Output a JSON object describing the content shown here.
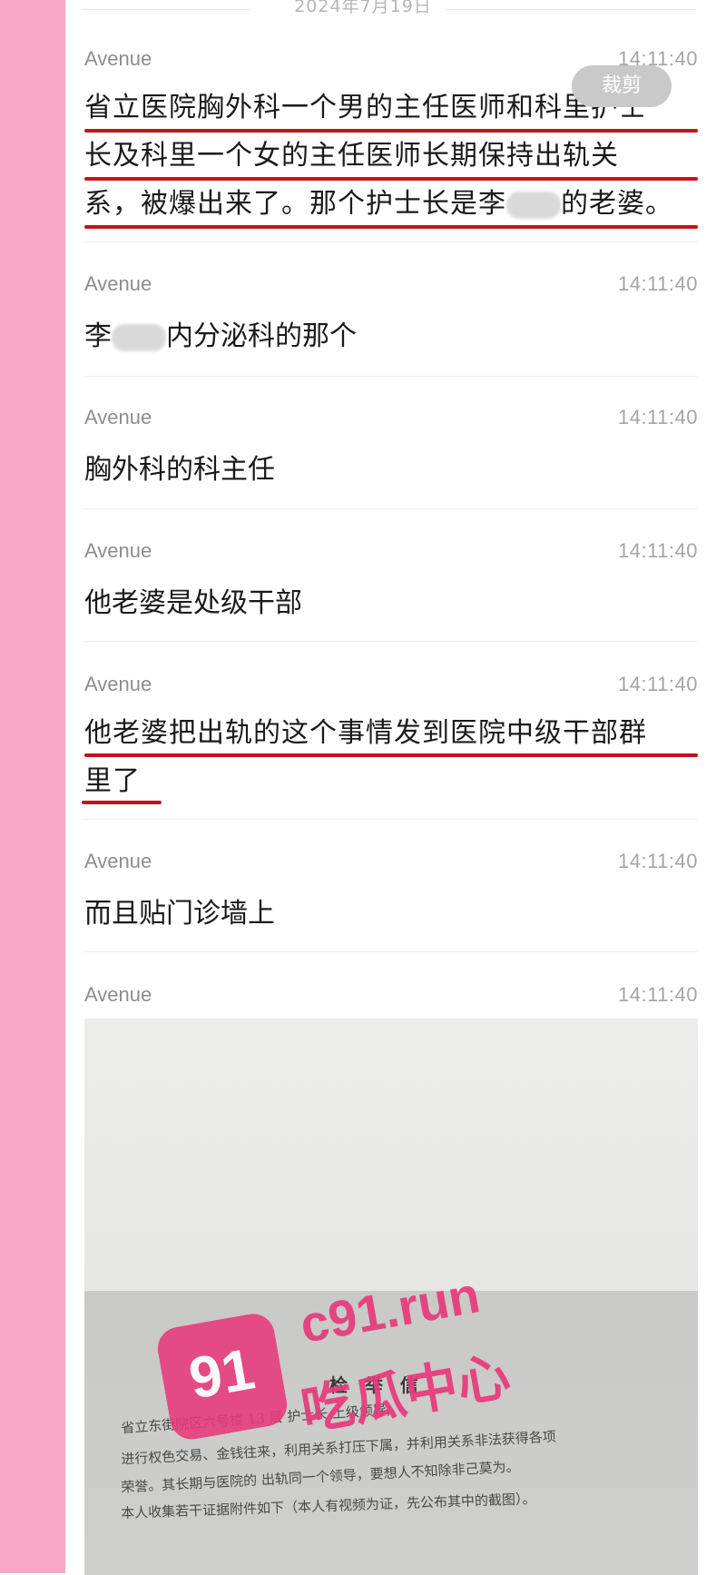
{
  "date_divider": "2024年7月19日",
  "crop_button": "裁剪",
  "messages": [
    {
      "sender": "Avenue",
      "time": "14:11:40",
      "lines": [
        "省立医院胸外科一个男的主任医师和科里护士",
        "长及科里一个女的主任医师长期保持出轨关",
        "系，被爆出来了。那个护士长是李",
        "的老婆。"
      ]
    },
    {
      "sender": "Avenue",
      "time": "14:11:40",
      "pre": "李",
      "post": "内分泌科的那个"
    },
    {
      "sender": "Avenue",
      "time": "14:11:40",
      "text": "胸外科的科主任"
    },
    {
      "sender": "Avenue",
      "time": "14:11:40",
      "text": "他老婆是处级干部"
    },
    {
      "sender": "Avenue",
      "time": "14:11:40",
      "lines": [
        "他老婆把出轨的这个事情发到医院中级干部群",
        "里了"
      ]
    },
    {
      "sender": "Avenue",
      "time": "14:11:40",
      "text": "而且贴门诊墙上"
    },
    {
      "sender": "Avenue",
      "time": "14:11:40"
    }
  ],
  "photo": {
    "title": "检 举 信",
    "lines": [
      "省立东街院区六号楼 13 层          护士长          上级领导,",
      "进行权色交易、金钱往来，利用关系打压下属，并利用关系非法获得各项",
      "荣誉。其长期与医院的          出轨同一个领导，要想人不知除非己莫为。",
      "本人收集若干证据附件如下（本人有视频为证，先公布其中的截图）。"
    ]
  },
  "watermark": {
    "domain": "c91.run",
    "name": "吃瓜中心",
    "logo": "91"
  },
  "colors": {
    "sidebar": "#f8a9c7",
    "underline": "#c4121f",
    "watermark": "#e8397a"
  }
}
